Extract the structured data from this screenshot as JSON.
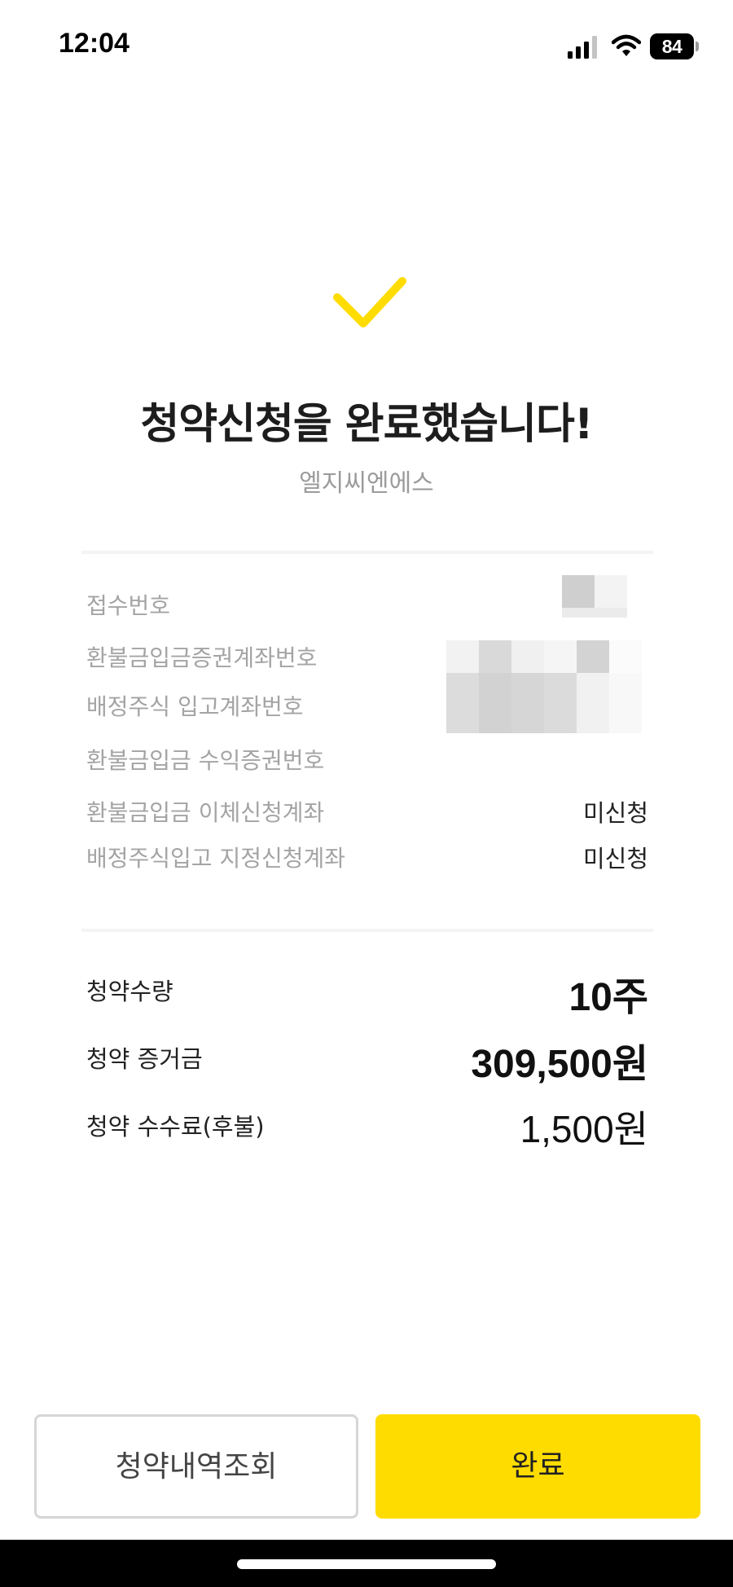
{
  "status_bar": {
    "time": "12:04",
    "battery": "84",
    "icons": [
      "signal-icon",
      "wifi-icon",
      "battery-icon"
    ]
  },
  "result": {
    "icon": "check-icon",
    "title": "청약신청을 완료했습니다!",
    "subtitle": "엘지씨엔에스"
  },
  "info": {
    "receipt_number_label": "접수번호",
    "refund_account_label": "환불금입금증권계좌번호",
    "allocation_account_label": "배정주식 입고계좌번호",
    "refund_income_account_label": "환불금입금 수익증권번호",
    "refund_transfer_label": "환불금입금 이체신청계좌",
    "refund_transfer_value": "미신청",
    "allocation_designated_label": "배정주식입고 지정신청계좌",
    "allocation_designated_value": "미신청"
  },
  "summary": {
    "quantity_label": "청약수량",
    "quantity_value": "10주",
    "deposit_label": "청약 증거금",
    "deposit_value": "309,500원",
    "fee_label": "청약 수수료(후불)",
    "fee_value": "1,500원"
  },
  "actions": {
    "history_button": "청약내역조회",
    "done_button": "완료"
  },
  "colors": {
    "accent": "#FFDC00",
    "check": "#FFDC00",
    "muted_text": "#A4A4A4"
  }
}
